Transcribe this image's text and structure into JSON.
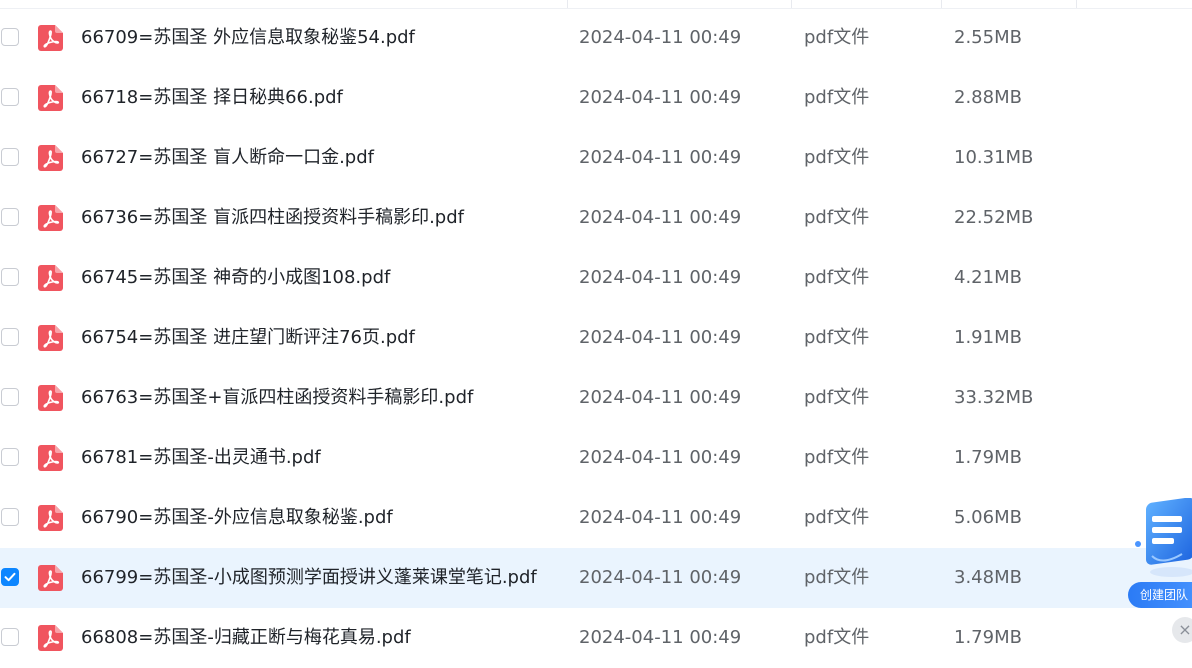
{
  "files": [
    {
      "name": "66709=苏国圣 外应信息取象秘鉴54.pdf",
      "date": "2024-04-11 00:49",
      "type": "pdf文件",
      "size": "2.55MB",
      "selected": false
    },
    {
      "name": "66718=苏国圣 择日秘典66.pdf",
      "date": "2024-04-11 00:49",
      "type": "pdf文件",
      "size": "2.88MB",
      "selected": false
    },
    {
      "name": "66727=苏国圣 盲人断命一口金.pdf",
      "date": "2024-04-11 00:49",
      "type": "pdf文件",
      "size": "10.31MB",
      "selected": false
    },
    {
      "name": "66736=苏国圣 盲派四柱函授资料手稿影印.pdf",
      "date": "2024-04-11 00:49",
      "type": "pdf文件",
      "size": "22.52MB",
      "selected": false
    },
    {
      "name": "66745=苏国圣 神奇的小成图108.pdf",
      "date": "2024-04-11 00:49",
      "type": "pdf文件",
      "size": "4.21MB",
      "selected": false
    },
    {
      "name": "66754=苏国圣 进庄望门断评注76页.pdf",
      "date": "2024-04-11 00:49",
      "type": "pdf文件",
      "size": "1.91MB",
      "selected": false
    },
    {
      "name": "66763=苏国圣+盲派四柱函授资料手稿影印.pdf",
      "date": "2024-04-11 00:49",
      "type": "pdf文件",
      "size": "33.32MB",
      "selected": false
    },
    {
      "name": "66781=苏国圣-出灵通书.pdf",
      "date": "2024-04-11 00:49",
      "type": "pdf文件",
      "size": "1.79MB",
      "selected": false
    },
    {
      "name": "66790=苏国圣-外应信息取象秘鉴.pdf",
      "date": "2024-04-11 00:49",
      "type": "pdf文件",
      "size": "5.06MB",
      "selected": false
    },
    {
      "name": "66799=苏国圣-小成图预测学面授讲义蓬莱课堂笔记.pdf",
      "date": "2024-04-11 00:49",
      "type": "pdf文件",
      "size": "3.48MB",
      "selected": true
    },
    {
      "name": "66808=苏国圣-归藏正断与梅花真易.pdf",
      "date": "2024-04-11 00:49",
      "type": "pdf文件",
      "size": "1.79MB",
      "selected": false
    }
  ],
  "file_icon": "pdf-file-icon",
  "team_widget": {
    "label": "创建团队",
    "icon": "team-3d-icon"
  },
  "close_widget": {
    "label": "×"
  },
  "colors": {
    "accent": "#0d86ff",
    "pdf_red": "#f0555f",
    "selected_row": "#eaf4fe"
  }
}
